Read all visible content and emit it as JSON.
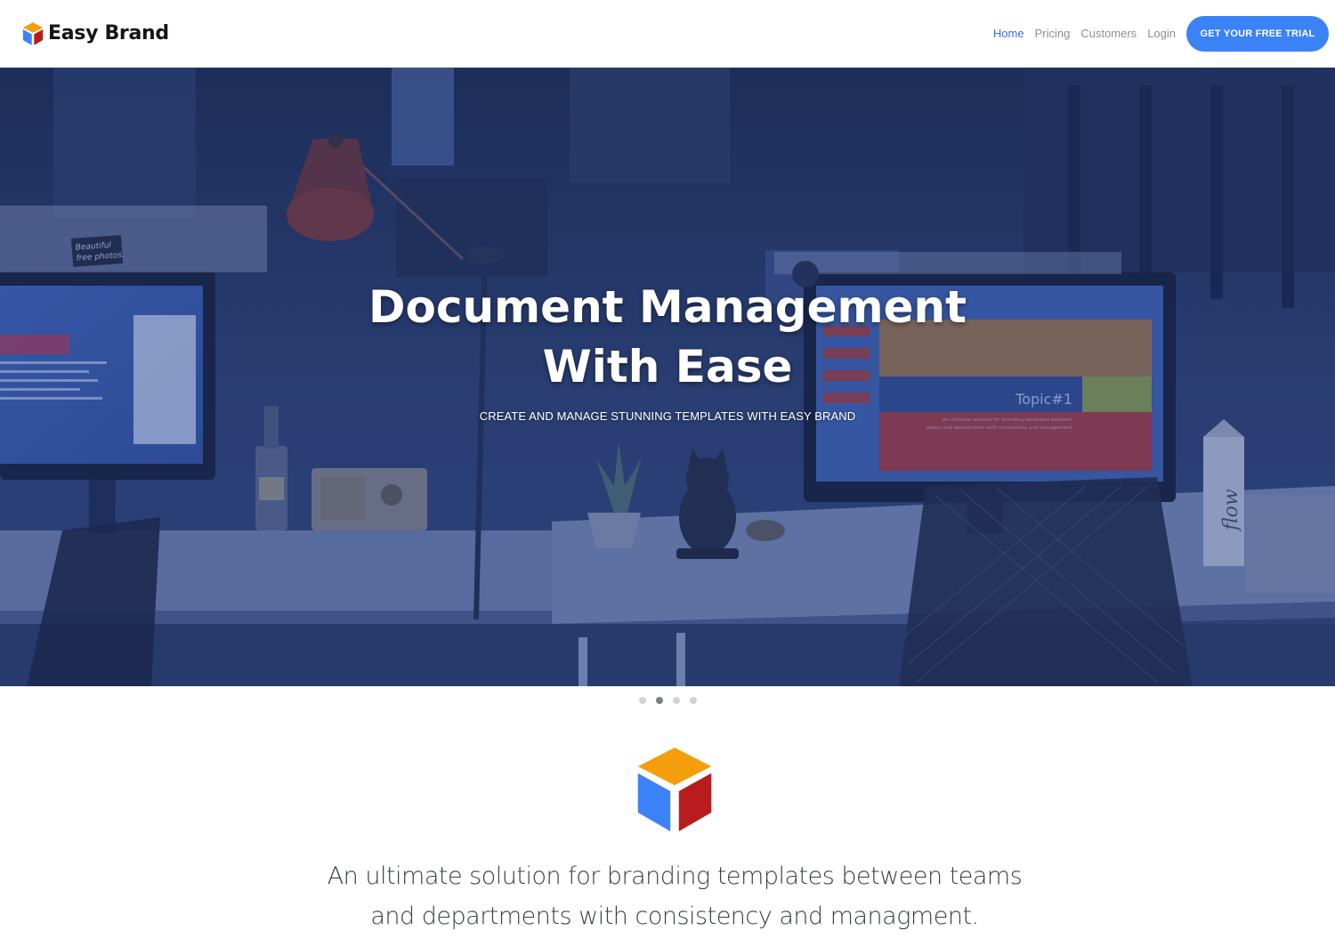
{
  "brand": {
    "name": "Easy Brand",
    "logo_icon": "cube-logo-icon",
    "colors": {
      "top": "#f59e0b",
      "left": "#3b82f6",
      "right": "#b91c1c"
    }
  },
  "nav": {
    "links": [
      {
        "label": "Home",
        "active": true
      },
      {
        "label": "Pricing",
        "active": false
      },
      {
        "label": "Customers",
        "active": false
      },
      {
        "label": "Login",
        "active": false
      }
    ],
    "cta_label": "GET YOUR FREE TRIAL"
  },
  "hero": {
    "title": "Document Management With Ease",
    "subtitle": "CREATE AND MANAGE STUNNING TEMPLATES WITH EASY BRAND",
    "image_texts": {
      "sticker": "Beautiful free photos.",
      "slide_topic": "Topic#1",
      "slide_caption": "An ultimate solution for branding templates between teams and departments with consistency and management",
      "carton_label": "flow"
    }
  },
  "carousel": {
    "slide_count": 4,
    "active_index": 1
  },
  "intro": {
    "text": "An ultimate solution for branding templates between teams and departments with consistency and managment."
  },
  "colors": {
    "accent": "#3b82f6",
    "nav_active": "#3b6fd1",
    "nav_text": "#8a8f98",
    "body_text": "#3a3f47"
  }
}
